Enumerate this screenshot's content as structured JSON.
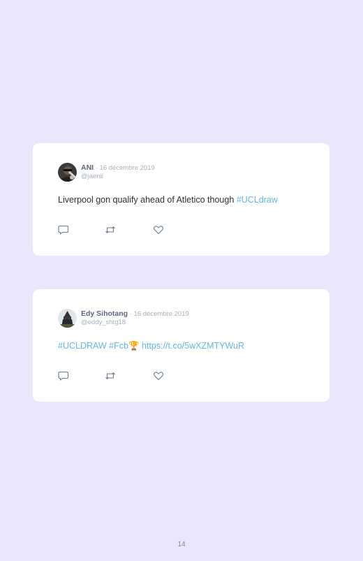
{
  "tweets": [
    {
      "author": "ANI",
      "separator": " · ",
      "date": "16 décembre 2019",
      "handle": "@jaenil",
      "text": "Liverpool gon qualify ahead of Atletico though ",
      "hashtags": "#UCLdraw",
      "avatar_icon": "profile-photo",
      "actions": [
        "reply-icon",
        "retweet-icon",
        "like-icon"
      ]
    },
    {
      "author": "Edy Sihotang",
      "separator": " · ",
      "date": "16 décembre 2019",
      "handle": "@eddy_shtg18",
      "hashtags": "#UCLDRAW #Fcb",
      "emoji": "🏆",
      "link": " https://t.co/5wXZMTYWuR",
      "avatar_icon": "profile-photo",
      "actions": [
        "reply-icon",
        "retweet-icon",
        "like-icon"
      ]
    }
  ],
  "page_number": "14",
  "colors": {
    "background": "#e9e6fd",
    "card": "#ffffff",
    "author": "#58677d",
    "meta": "#a9afb9",
    "text": "#2c2f35",
    "link": "#62b6e4",
    "icon": "#6b7a8f"
  }
}
